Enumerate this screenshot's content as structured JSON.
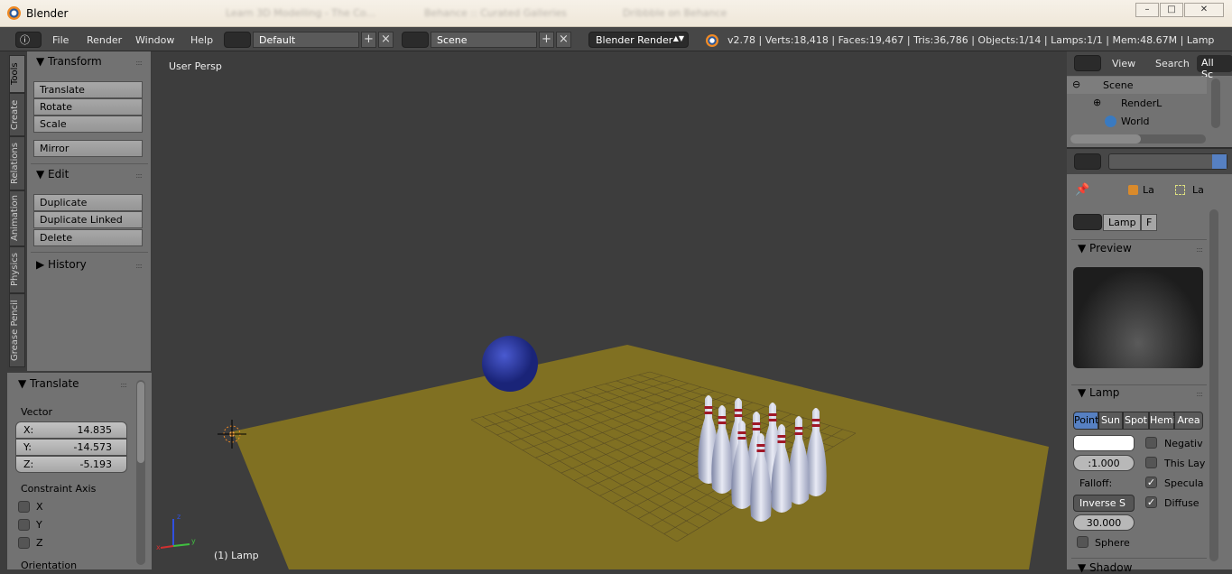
{
  "window": {
    "title": "Blender",
    "browser_tabs": [
      "Learn 3D Modelling - The Co...",
      "Behance :: Curated Galleries",
      "Dribbble on Behance"
    ]
  },
  "header": {
    "menus": [
      "File",
      "Render",
      "Window",
      "Help"
    ],
    "layout": "Default",
    "scene": "Scene",
    "engine": "Blender Render",
    "stats": "v2.78 | Verts:18,418 | Faces:19,467 | Tris:36,786 | Objects:1/14 | Lamps:1/1 | Mem:48.67M | Lamp"
  },
  "tool_tabs": [
    "Tools",
    "Create",
    "Relations",
    "Animation",
    "Physics",
    "Grease Pencil"
  ],
  "tools": {
    "transform": {
      "title": "Transform",
      "buttons": [
        "Translate",
        "Rotate",
        "Scale",
        "Mirror"
      ]
    },
    "edit": {
      "title": "Edit",
      "buttons": [
        "Duplicate",
        "Duplicate Linked",
        "Delete"
      ]
    },
    "history": {
      "title": "History"
    }
  },
  "operator": {
    "title": "Translate",
    "vector_label": "Vector",
    "x_label": "X:",
    "x": "14.835",
    "y_label": "Y:",
    "y": "-14.573",
    "z_label": "Z:",
    "z": "-5.193",
    "constraint_label": "Constraint Axis",
    "axes": [
      "X",
      "Y",
      "Z"
    ],
    "orientation_label": "Orientation"
  },
  "viewport": {
    "view_label": "User Persp",
    "object_label": "(1) Lamp",
    "axis_labels": {
      "x": "x",
      "y": "y",
      "z": "z"
    }
  },
  "outliner": {
    "view": "View",
    "search": "Search",
    "filter": "All Sc",
    "items": [
      "Scene",
      "RenderL",
      "World"
    ]
  },
  "properties": {
    "breadcrumb": [
      "La",
      "La"
    ],
    "datablock": "Lamp",
    "fake": "F",
    "preview_title": "Preview",
    "lamp_title": "Lamp",
    "lamp_types": [
      "Point",
      "Sun",
      "Spot",
      "Hemi",
      "Area"
    ],
    "selected_type": "Point",
    "energy": ":1.000",
    "falloff_label": "Falloff:",
    "falloff": "Inverse S",
    "distance": "30.000",
    "checks": [
      {
        "label": "Negativ",
        "checked": false
      },
      {
        "label": "This Lay",
        "checked": false
      },
      {
        "label": "Specula",
        "checked": true
      },
      {
        "label": "Diffuse",
        "checked": true
      }
    ],
    "sphere": "Sphere",
    "shadow_title": "Shadow"
  },
  "colors": {
    "plane": "#807022",
    "ball": "#2a3a9e",
    "accent": "#5680c2"
  }
}
